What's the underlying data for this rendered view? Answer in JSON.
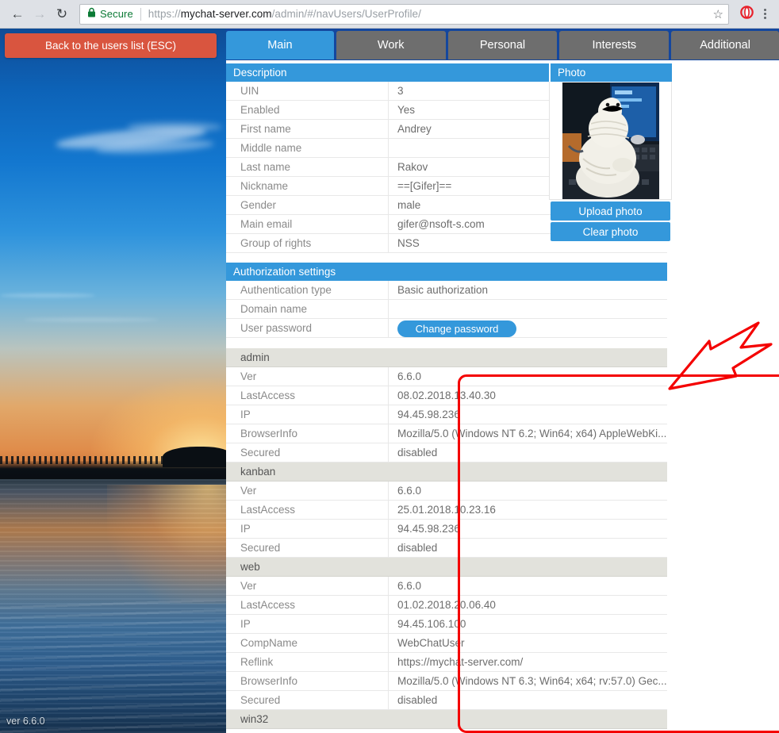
{
  "browser": {
    "back_icon": "arrow-left-icon",
    "forward_icon": "arrow-right-icon",
    "reload_icon": "reload-icon",
    "lock_icon": "lock-icon",
    "secure_label": "Secure",
    "url_scheme": "https://",
    "url_host": "mychat-server.com",
    "url_path": "/admin/#/navUsers/UserProfile/",
    "url_full": "https://mychat-server.com/admin/#/navUsers/UserProfile/",
    "bookmark_icon": "star-icon",
    "extension_icon": "opera-vpn-icon",
    "menu_icon": "kebab-menu-icon"
  },
  "sidebar": {
    "back_button": "Back to the users list (ESC)",
    "version": "ver 6.6.0"
  },
  "tabs": [
    {
      "label": "Main",
      "active": true
    },
    {
      "label": "Work",
      "active": false
    },
    {
      "label": "Personal",
      "active": false
    },
    {
      "label": "Interests",
      "active": false
    },
    {
      "label": "Additional",
      "active": false
    }
  ],
  "description": {
    "header": "Description",
    "rows": [
      {
        "label": "UIN",
        "value": "3"
      },
      {
        "label": "Enabled",
        "value": "Yes"
      },
      {
        "label": "First name",
        "value": "Andrey"
      },
      {
        "label": "Middle name",
        "value": ""
      },
      {
        "label": "Last name",
        "value": "Rakov"
      },
      {
        "label": "Nickname",
        "value": "==[Gifer]=="
      },
      {
        "label": "Gender",
        "value": "male"
      },
      {
        "label": "Main email",
        "value": "gifer@nsoft-s.com"
      },
      {
        "label": "Group of rights",
        "value": "NSS"
      }
    ]
  },
  "photo": {
    "header": "Photo",
    "image_alt": "user-avatar-photo",
    "upload_label": "Upload photo",
    "clear_label": "Clear photo"
  },
  "authorization": {
    "header": "Authorization settings",
    "rows": [
      {
        "label": "Authentication type",
        "value": "Basic authorization"
      },
      {
        "label": "Domain name",
        "value": ""
      }
    ],
    "password_label": "User password",
    "change_password_label": "Change password"
  },
  "sessions": [
    {
      "name": "admin",
      "rows": [
        {
          "label": "Ver",
          "value": "6.6.0"
        },
        {
          "label": "LastAccess",
          "value": "08.02.2018.13.40.30"
        },
        {
          "label": "IP",
          "value": "94.45.98.236"
        },
        {
          "label": "BrowserInfo",
          "value": "Mozilla/5.0 (Windows NT 6.2; Win64; x64) AppleWebKi..."
        },
        {
          "label": "Secured",
          "value": "disabled"
        }
      ]
    },
    {
      "name": "kanban",
      "rows": [
        {
          "label": "Ver",
          "value": "6.6.0"
        },
        {
          "label": "LastAccess",
          "value": "25.01.2018.10.23.16"
        },
        {
          "label": "IP",
          "value": "94.45.98.236"
        },
        {
          "label": "Secured",
          "value": "disabled"
        }
      ]
    },
    {
      "name": "web",
      "rows": [
        {
          "label": "Ver",
          "value": "6.6.0"
        },
        {
          "label": "LastAccess",
          "value": "01.02.2018.20.06.40"
        },
        {
          "label": "IP",
          "value": "94.45.106.100"
        },
        {
          "label": "CompName",
          "value": "WebChatUser"
        },
        {
          "label": "Reflink",
          "value": "https://mychat-server.com/"
        },
        {
          "label": "BrowserInfo",
          "value": "Mozilla/5.0 (Windows NT 6.3; Win64; x64; rv:57.0) Gec..."
        },
        {
          "label": "Secured",
          "value": "disabled"
        }
      ]
    },
    {
      "name": "win32",
      "rows": []
    }
  ],
  "annotation": {
    "highlight_color": "#f40000",
    "arrow_name": "red-arrow-annotation"
  },
  "colors": {
    "accent_blue": "#3498db",
    "tabstrip_navy": "#14479e",
    "inactive_tab_gray": "#6e6e6e",
    "back_button_red": "#d9553f",
    "group_header_gray": "#e2e2dc"
  }
}
